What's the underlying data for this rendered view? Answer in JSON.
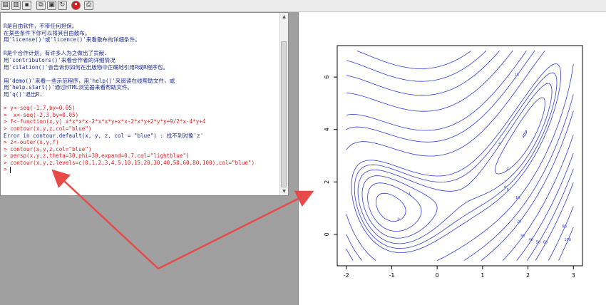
{
  "toolbar": {
    "buttons": [
      {
        "icon": "open-script-icon"
      },
      {
        "icon": "load-workspace-icon"
      },
      {
        "icon": "save-icon"
      },
      {
        "icon": "copy-icon"
      },
      {
        "icon": "paste-icon"
      },
      {
        "icon": "copy-paste-icon"
      },
      {
        "icon": "stop-icon",
        "label": "STOP"
      },
      {
        "icon": "print-icon"
      }
    ]
  },
  "console": {
    "lines": [
      {
        "type": "info",
        "text": "R是自由软件，不带任何担保。"
      },
      {
        "type": "info",
        "text": "在某些条件下你可以将其自由散布。"
      },
      {
        "type": "info",
        "text": "用'license()'或'licence()'来看散布的详细条件。"
      },
      {
        "type": "gap",
        "text": ""
      },
      {
        "type": "info",
        "text": "R是个合作计划，有许多人为之做出了贡献."
      },
      {
        "type": "info",
        "text": "用'contributors()'来看合作者的详细情况"
      },
      {
        "type": "info",
        "text": "用'citation()'会告诉你如何在出版物中正确地引用R或R程序包。"
      },
      {
        "type": "gap",
        "text": ""
      },
      {
        "type": "info",
        "text": "用'demo()'来看一些示范程序，用'help()'来阅读在线帮助文件，或"
      },
      {
        "type": "info",
        "text": "用'help.start()'通过HTML浏览器来看帮助文件。"
      },
      {
        "type": "info",
        "text": "用'q()'退出R."
      },
      {
        "type": "gap",
        "text": ""
      },
      {
        "type": "cmd",
        "text": "> y<-seq(-1,7,by=0.05)"
      },
      {
        "type": "cmd",
        "text": ">  x<-seq(-2,3,by=0.05)"
      },
      {
        "type": "cmd",
        "text": "> f<-function(x,y) x*x*x*x-2*x*x*y+x*x-2*x*y+2*y*y+9/2*x-4*y+4"
      },
      {
        "type": "cmd",
        "text": "> contour(x,y,z,col=\"blue\")"
      },
      {
        "type": "err",
        "text": "Error in contour.default(x, y, z, col = \"blue\") : 找不到对象'z'"
      },
      {
        "type": "cmd",
        "text": "> z<-outer(x,y,f)"
      },
      {
        "type": "cmd",
        "text": "> contour(x,y,z,col=\"blue\")"
      },
      {
        "type": "cmd",
        "text": "> persp(x,y,z,theta=30,phi=30,expand=0.7,col=\"lightblue\")"
      },
      {
        "type": "cmd",
        "text": "> contour(x,y,z,levels=c(0,1,2,3,4,5,10,15,20,30,40,50,60,80,100),col=\"blue\")"
      },
      {
        "type": "prompt",
        "text": "> "
      }
    ]
  },
  "chart_data": {
    "type": "contour",
    "function": "x^4-2x^2y+x^2-2xy+2y^2+4.5x-4y+4",
    "x": {
      "from": -2,
      "to": 3,
      "by": 0.05
    },
    "y": {
      "from": -1,
      "to": 7,
      "by": 0.05
    },
    "levels": [
      0,
      1,
      2,
      3,
      4,
      5,
      10,
      15,
      20,
      30,
      40,
      50,
      60,
      80,
      100
    ],
    "xlim": [
      -2.2,
      3.2
    ],
    "ylim": [
      -1.2,
      7.2
    ],
    "xticks": [
      "-2",
      "-1",
      "0",
      "1",
      "2",
      "3"
    ],
    "yticks": [
      "0",
      "2",
      "4",
      "6"
    ],
    "line_color": "#2e3cd6",
    "title": "",
    "xlabel": "",
    "ylabel": ""
  },
  "colors": {
    "console_text": "#1c2a9a",
    "command": "#e02020",
    "annotation_arrow": "#e84a4a"
  }
}
